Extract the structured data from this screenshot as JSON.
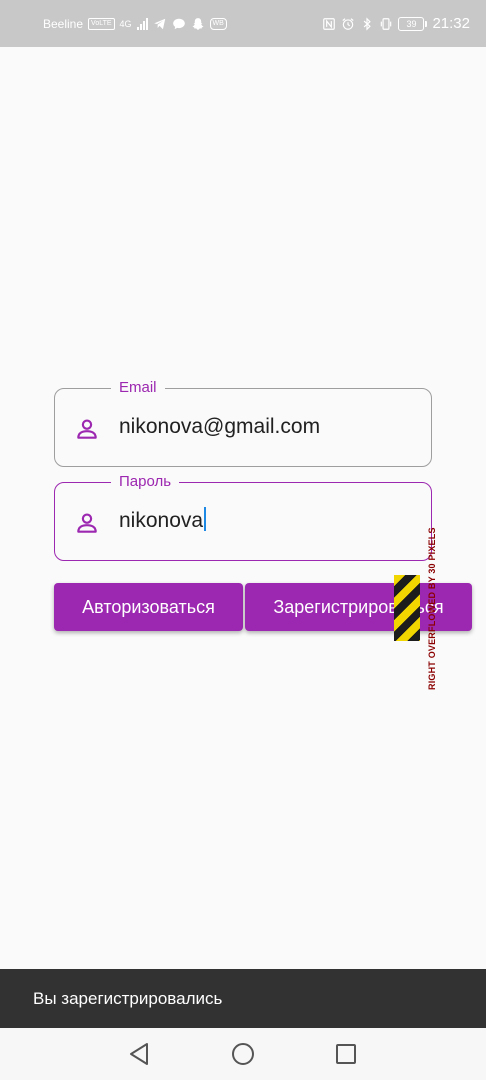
{
  "status_bar": {
    "carrier": "Beeline",
    "volte_badge": "VoLTE",
    "network": "4G",
    "battery": "39",
    "time": "21:32",
    "left_icons": [
      "signal-icon",
      "telegram-icon",
      "message-icon",
      "snapchat-icon",
      "wb-icon"
    ],
    "wb_badge": "WB",
    "right_icons": [
      "nfc-icon",
      "alarm-icon",
      "bluetooth-icon",
      "vibrate-icon",
      "battery-icon"
    ]
  },
  "form": {
    "email": {
      "label": "Email",
      "value": "nikonova@gmail.com",
      "icon": "person-icon"
    },
    "password": {
      "label": "Пароль",
      "value": "nikonova",
      "icon": "person-icon",
      "focused": true
    },
    "login_button": "Авторизоваться",
    "register_button": "Зарегистрироваться"
  },
  "overflow": {
    "message": "RIGHT OVERFLOWED BY 30 PIXELS"
  },
  "snackbar": {
    "message": "Вы зарегистрировались"
  },
  "nav_bar": {
    "buttons": [
      "back-icon",
      "home-icon",
      "recents-icon"
    ]
  },
  "colors": {
    "accent": "#9c27b0",
    "status_bar": "#c8c8c8",
    "snackbar": "#323232",
    "background": "#fafafa",
    "cursor": "#1e88e5"
  }
}
